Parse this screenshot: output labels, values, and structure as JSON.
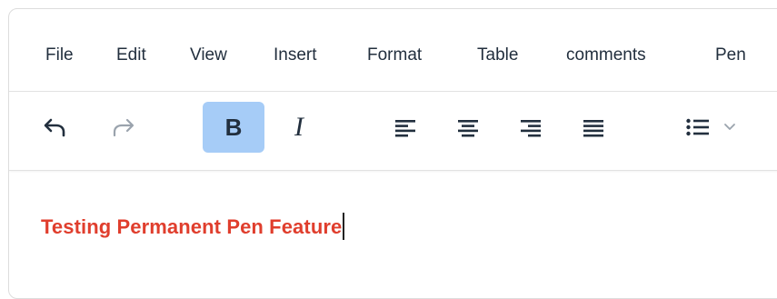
{
  "menubar": {
    "items": [
      "File",
      "Edit",
      "View",
      "Insert",
      "Format",
      "Table",
      "comments",
      "Pen"
    ]
  },
  "toolbar": {
    "bold_label": "B",
    "italic_label": "I",
    "icons": [
      "undo-icon",
      "redo-icon",
      "align-left-icon",
      "align-center-icon",
      "align-right-icon",
      "align-justify-icon",
      "bullet-list-icon",
      "chevron-down-icon"
    ]
  },
  "content": {
    "text": "Testing Permanent Pen Feature",
    "text_color": "#e03e2d"
  },
  "colors": {
    "active_button": "#a6ccf7",
    "icon": "#222f3e",
    "disabled_icon": "#9aa3ad"
  }
}
